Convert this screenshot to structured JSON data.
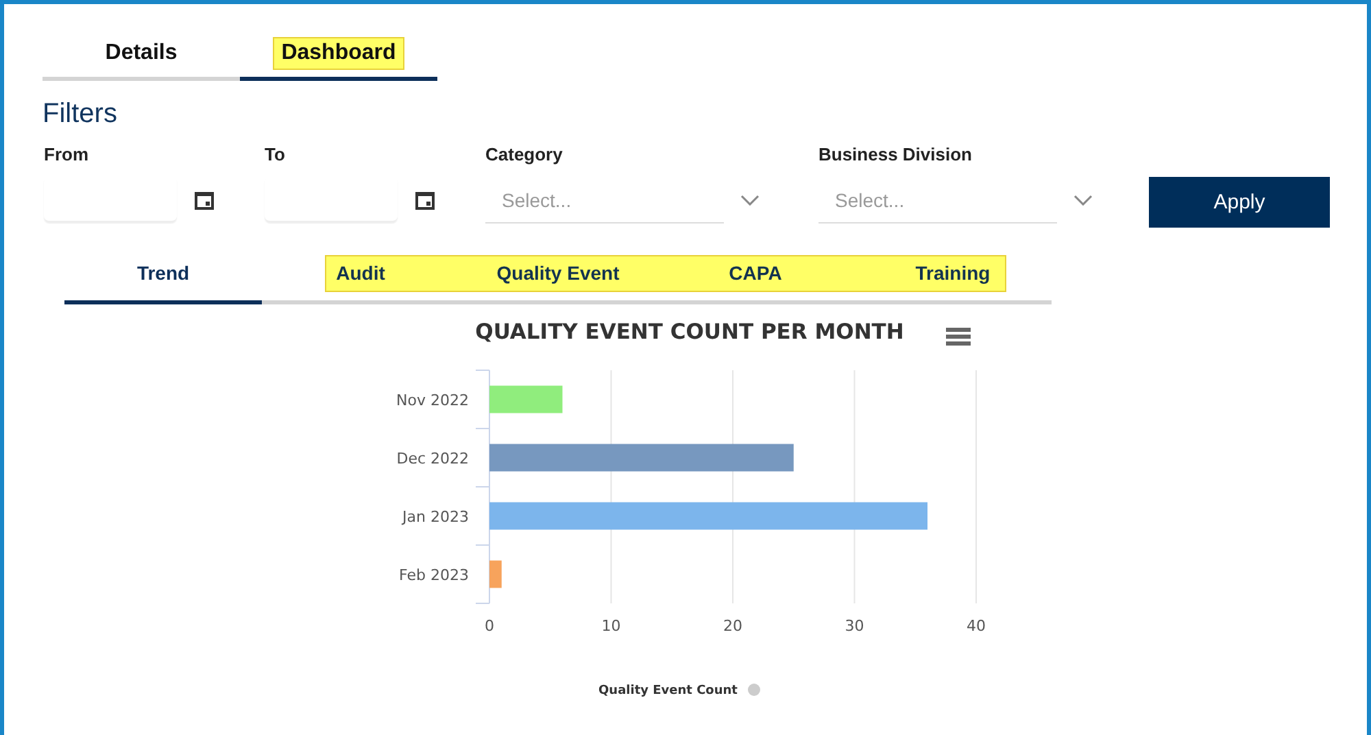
{
  "main_tabs": [
    {
      "label": "Details",
      "selected": false,
      "highlighted": false
    },
    {
      "label": "Dashboard",
      "selected": true,
      "highlighted": true
    }
  ],
  "filters": {
    "title": "Filters",
    "fields": [
      {
        "kind": "date",
        "label": "From"
      },
      {
        "kind": "date",
        "label": "To"
      },
      {
        "kind": "select",
        "label": "Category",
        "placeholder": "Select..."
      },
      {
        "kind": "select",
        "label": "Business Division",
        "placeholder": "Select..."
      }
    ],
    "apply_button": "Apply"
  },
  "sub_tabs": {
    "highlighted": true,
    "items": [
      {
        "label": "Trend",
        "selected": true
      },
      {
        "label": "Audit",
        "selected": false
      },
      {
        "label": "Quality Event",
        "selected": false
      },
      {
        "label": "CAPA",
        "selected": false
      },
      {
        "label": "Training",
        "selected": false
      }
    ]
  },
  "chart": {
    "chart_data": {
      "type": "bar",
      "orientation": "horizontal",
      "title": "QUALITY EVENT COUNT PER MONTH",
      "categories": [
        "Nov 2022",
        "Dec 2022",
        "Jan 2023",
        "Feb 2023"
      ],
      "series": [
        {
          "name": "Quality Event Count",
          "values": [
            6,
            25,
            36,
            1
          ]
        }
      ],
      "grid": true,
      "xlim": [
        0,
        40
      ],
      "xticks": [
        0,
        10,
        20,
        30,
        40
      ]
    },
    "bars": [
      {
        "color": "#90ed7d"
      },
      {
        "color": "#7798bf"
      },
      {
        "color": "#7cb5ec"
      },
      {
        "color": "#f7a35c"
      }
    ],
    "legend_marker": {
      "color": "#cccccc"
    }
  }
}
